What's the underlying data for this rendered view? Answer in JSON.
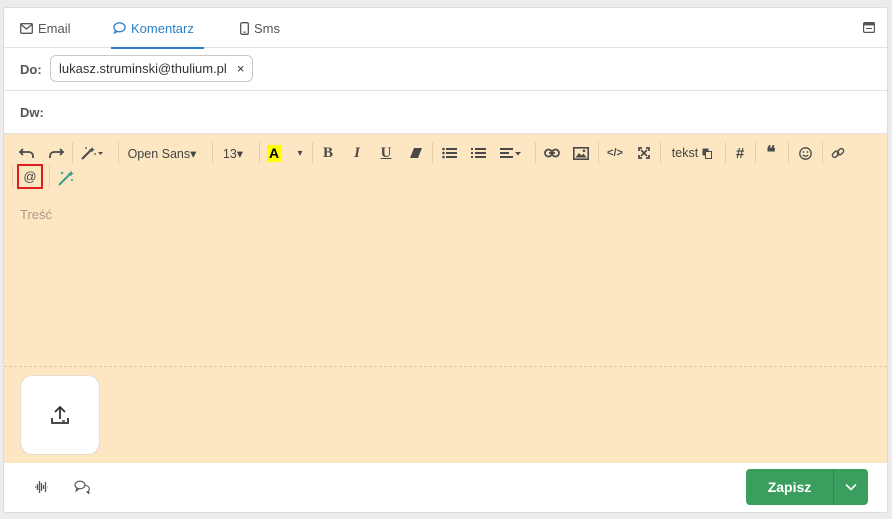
{
  "tabs": [
    {
      "label": "Email",
      "icon": "envelope-icon"
    },
    {
      "label": "Komentarz",
      "icon": "speech-bubble-icon",
      "active": true
    },
    {
      "label": "Sms",
      "icon": "phone-icon"
    }
  ],
  "to": {
    "label": "Do:",
    "recipient": "lukasz.struminski@thulium.pl",
    "remove": "×"
  },
  "dw": {
    "label": "Dw:",
    "value": ""
  },
  "toolbar": {
    "font": "Open Sans▾",
    "size": "13▾",
    "color_letter": "A",
    "color_caret": "▾",
    "bold": "B",
    "italic": "I",
    "underline": "U",
    "code": "</>",
    "template": "tekst",
    "hash": "#",
    "quote": "❝",
    "mention": "@"
  },
  "editor": {
    "placeholder": "Treść"
  },
  "footer": {
    "save": "Zapisz"
  },
  "colors": {
    "accent": "#2d7fc4",
    "editor_bg": "#fde7c3",
    "save_bg": "#3a9e5f",
    "highlight": "#ffff00"
  }
}
